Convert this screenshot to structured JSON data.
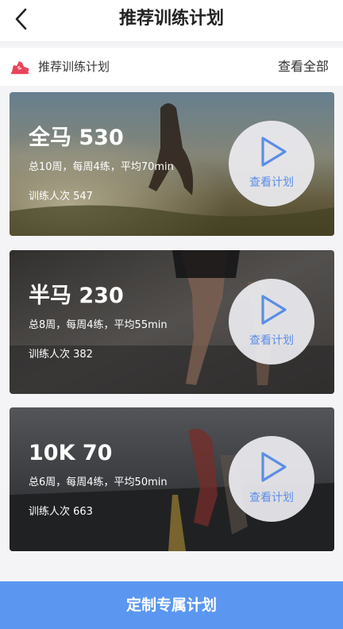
{
  "header": {
    "back_icon": "chevron-left-icon",
    "title": "推荐训练计划"
  },
  "section": {
    "icon": "running-shoe-icon",
    "title": "推荐训练计划",
    "view_all": "查看全部",
    "accent_color": "#e8455a"
  },
  "plans": [
    {
      "title": "全马 530",
      "summary": "总10周，每周4练，平均70min",
      "participants": "训练人次 547",
      "action": "查看计划"
    },
    {
      "title": "半马 230",
      "summary": "总8周，每周4练，平均55min",
      "participants": "训练人次 382",
      "action": "查看计划"
    },
    {
      "title": "10K 70",
      "summary": "总6周，每周4练，平均50min",
      "participants": "训练人次 663",
      "action": "查看计划"
    }
  ],
  "footer": {
    "button_label": "定制专属计划",
    "button_color": "#5b97f1"
  },
  "theme": {
    "play_icon": "play-triangle-icon",
    "play_color": "#5b8ee6"
  }
}
